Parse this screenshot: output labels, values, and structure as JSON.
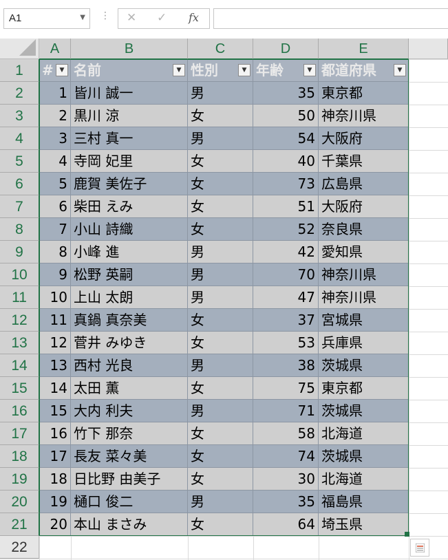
{
  "formula_bar": {
    "name_box": "A1",
    "name_box_dropdown_icon": "chevron-down-icon",
    "options_icon": "vertical-dots-icon",
    "cancel_icon": "close-icon",
    "enter_icon": "check-icon",
    "function_icon": "fx-icon",
    "formula_value": ""
  },
  "sheet": {
    "columns": [
      "A",
      "B",
      "C",
      "D",
      "E"
    ],
    "row_numbers": [
      "1",
      "2",
      "3",
      "4",
      "5",
      "6",
      "7",
      "8",
      "9",
      "10",
      "11",
      "12",
      "13",
      "14",
      "15",
      "16",
      "17",
      "18",
      "19",
      "20",
      "21",
      "22"
    ],
    "table_headers": [
      "#",
      "名前",
      "性別",
      "年齢",
      "都道府県"
    ],
    "rows": [
      [
        "1",
        "皆川 誠一",
        "男",
        "35",
        "東京都"
      ],
      [
        "2",
        "黒川 涼",
        "女",
        "50",
        "神奈川県"
      ],
      [
        "3",
        "三村 真一",
        "男",
        "54",
        "大阪府"
      ],
      [
        "4",
        "寺岡 妃里",
        "女",
        "40",
        "千葉県"
      ],
      [
        "5",
        "鹿賀 美佐子",
        "女",
        "73",
        "広島県"
      ],
      [
        "6",
        "柴田 えみ",
        "女",
        "51",
        "大阪府"
      ],
      [
        "7",
        "小山 詩織",
        "女",
        "52",
        "奈良県"
      ],
      [
        "8",
        "小峰 進",
        "男",
        "42",
        "愛知県"
      ],
      [
        "9",
        "松野 英嗣",
        "男",
        "70",
        "神奈川県"
      ],
      [
        "10",
        "上山 太朗",
        "男",
        "47",
        "神奈川県"
      ],
      [
        "11",
        "真鍋 真奈美",
        "女",
        "37",
        "宮城県"
      ],
      [
        "12",
        "菅井 みゆき",
        "女",
        "53",
        "兵庫県"
      ],
      [
        "13",
        "西村 光良",
        "男",
        "38",
        "茨城県"
      ],
      [
        "14",
        "太田 薫",
        "女",
        "75",
        "東京都"
      ],
      [
        "15",
        "大内 利夫",
        "男",
        "71",
        "茨城県"
      ],
      [
        "16",
        "竹下 那奈",
        "女",
        "58",
        "北海道"
      ],
      [
        "17",
        "長友 菜々美",
        "女",
        "74",
        "茨城県"
      ],
      [
        "18",
        "日比野 由美子",
        "女",
        "30",
        "北海道"
      ],
      [
        "19",
        "樋口 俊二",
        "男",
        "35",
        "福島県"
      ],
      [
        "20",
        "本山 まさみ",
        "女",
        "64",
        "埼玉県"
      ]
    ],
    "filter_icon": "filter-dropdown-icon",
    "quick_analysis_icon": "quick-analysis-icon",
    "colors": {
      "header_green": "#217346",
      "band_dark": "#a4afbd",
      "band_light": "#cfcfcf",
      "table_header": "#aab3c0"
    }
  }
}
